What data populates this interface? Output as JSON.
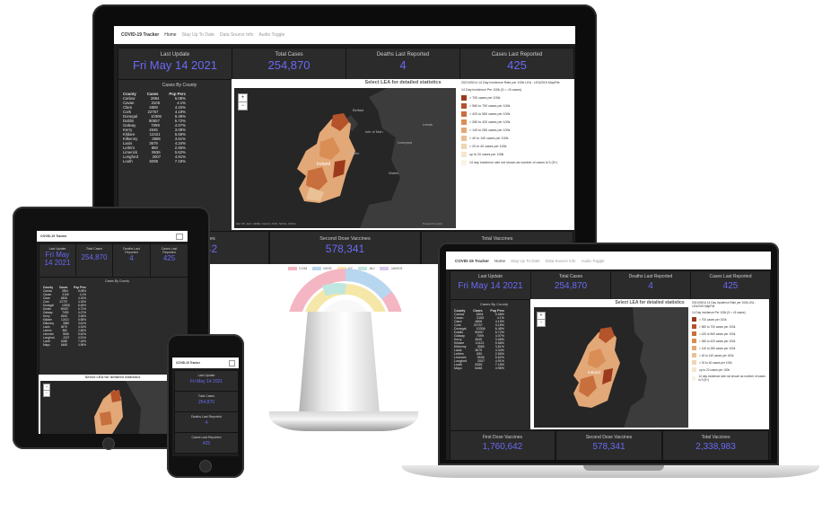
{
  "app": {
    "title": "COVID-19 Tracker"
  },
  "nav": {
    "links": [
      "Home",
      "Stay Up To Date",
      "Data Source Info",
      "Audio Toggle"
    ]
  },
  "cards": {
    "last_update": {
      "label": "Last Update",
      "value": "Fri May 14 2021",
      "value_tablet_line1": "Fri May",
      "value_tablet_line2": "14 2021"
    },
    "total_cases": {
      "label": "Total Cases",
      "value": "254,870"
    },
    "deaths": {
      "label": "Deaths Last Reported",
      "label_tablet_line1": "Deaths Last",
      "label_tablet_line2": "Reported",
      "value": "4"
    },
    "cases_reported": {
      "label": "Cases Last Reported",
      "label_tablet_line1": "Cases Last",
      "label_tablet_line2": "Reported",
      "value": "425"
    }
  },
  "county_panel": {
    "title": "Cases By County",
    "columns": [
      "County",
      "Cases",
      "Pop Perc"
    ],
    "rows": [
      [
        "Carlow",
        "2894",
        "5.08%"
      ],
      [
        "Cavan",
        "3105",
        "4.1%"
      ],
      [
        "Clare",
        "4808",
        "4.15%"
      ],
      [
        "Cork",
        "22757",
        "4.18%"
      ],
      [
        "Donegal",
        "10306",
        "6.48%"
      ],
      [
        "Dublin",
        "90557",
        "6.72%"
      ],
      [
        "Galway",
        "7099",
        "4.07%"
      ],
      [
        "Kerry",
        "4545",
        "3.08%"
      ],
      [
        "Kildare",
        "12421",
        "5.58%"
      ],
      [
        "Kilkenny",
        "3585",
        "3.61%"
      ],
      [
        "Laois",
        "3679",
        "4.34%"
      ],
      [
        "Leitrim",
        "850",
        "2.65%"
      ],
      [
        "Limerick",
        "9536",
        "5.62%"
      ],
      [
        "Longford",
        "2007",
        "4.91%"
      ],
      [
        "Louth",
        "8285",
        "7.18%"
      ],
      [
        "Mayo",
        "6468",
        "4.96%"
      ]
    ]
  },
  "map": {
    "title": "Select LEA for detailed statistics",
    "zoom_in": "+",
    "zoom_out": "−",
    "attribution": "Esri UK, Esri, HERE, Garmin, FAO, NOAA, USGS",
    "powered": "Powered by Esri",
    "places": [
      "Belfast",
      "Dublin",
      "Isle of Man",
      "Leeds",
      "Liverpool",
      "Wales",
      "Ireland"
    ]
  },
  "legend": {
    "title": "2021/05/14 14 Day Incidence Rate per 100k LEA - LEA2019 MapFile",
    "subtitle": "14 Day Incidence Per 100k (5 = <5 cases)",
    "items": [
      "> 700 cases per 100k",
      "> 560 to 700 cases per 100k",
      "> 420 to 560 cases per 100k",
      "> 280 to 420 cases per 100k",
      "> 140 to 280 cases per 100k",
      "> 40 to 140 cases per 100k",
      "> 20 to 40 cases per 100k",
      "up to 20 cases per 100k",
      "14 day incidence rate not shown as number of cases is 5 (5+)"
    ],
    "colors": [
      "#9c3a1e",
      "#b5532b",
      "#c8703d",
      "#d98e55",
      "#e3a877",
      "#eac195",
      "#f0d6b4",
      "#f6e6cd",
      "#fbf3e4"
    ]
  },
  "vaccines": {
    "first": {
      "label": "First Dose Vaccines",
      "value": "1,760,642"
    },
    "second": {
      "label": "Second Dose Vaccines",
      "value": "578,341"
    },
    "total": {
      "label": "Total Vaccines",
      "value": "2,338,983"
    }
  },
  "vaccine_chart": {
    "legend": [
      "COM",
      "MOD",
      "AZ",
      "J&J",
      "JANSS"
    ],
    "colors": [
      "#f4b6c2",
      "#b7d7f0",
      "#f5e7a8",
      "#bfe6e0",
      "#d9c8f0"
    ]
  }
}
